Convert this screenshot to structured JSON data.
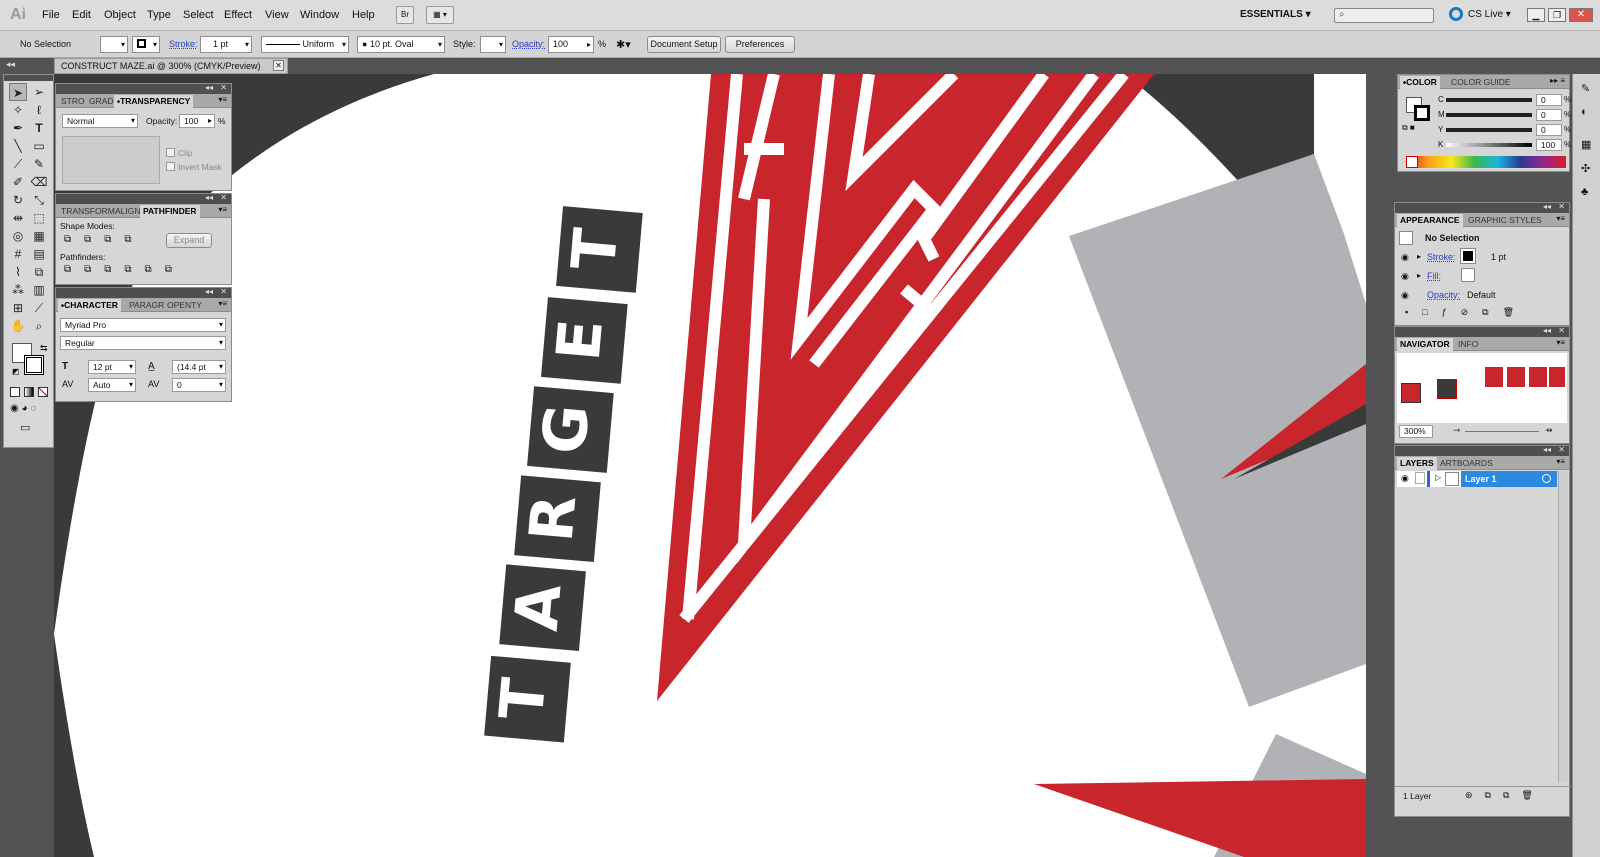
{
  "app": {
    "logo": "Ai"
  },
  "menu": [
    "File",
    "Edit",
    "Object",
    "Type",
    "Select",
    "Effect",
    "View",
    "Window",
    "Help"
  ],
  "menubar": {
    "bridge_btn": "Br",
    "workspace": "ESSENTIALS",
    "search_placeholder": "",
    "cslive": "CS Live"
  },
  "control": {
    "selection": "No Selection",
    "stroke_label": "Stroke:",
    "stroke_value": "1 pt",
    "profile": "Uniform",
    "brush": "10 pt. Oval",
    "style_label": "Style:",
    "opacity_label": "Opacity:",
    "opacity_value": "100",
    "opacity_unit": "%",
    "doc_setup": "Document Setup",
    "prefs": "Preferences"
  },
  "document": {
    "tab": "CONSTRUCT MAZE.ai @ 300% (CMYK/Preview)"
  },
  "transparency_panel": {
    "tabs": [
      "STRO",
      "GRAD",
      "TRANSPARENCY"
    ],
    "blend": "Normal",
    "opacity_label": "Opacity:",
    "opacity": "100",
    "unit": "%",
    "clip": "Clip",
    "invert": "Invert Mask"
  },
  "pathfinder_panel": {
    "tabs": [
      "TRANSFORM",
      "ALIGN",
      "PATHFINDER"
    ],
    "shape_modes": "Shape Modes:",
    "expand": "Expand",
    "pathfinders": "Pathfinders:"
  },
  "character_panel": {
    "tabs": [
      "CHARACTER",
      "PARAGR",
      "OPENTY"
    ],
    "font": "Myriad Pro",
    "style": "Regular",
    "size": "12 pt",
    "leading": "(14.4 pt",
    "kerning": "Auto",
    "tracking": "0"
  },
  "color_panel": {
    "tabs": [
      "COLOR",
      "COLOR GUIDE"
    ],
    "channels": [
      {
        "name": "C",
        "value": "0"
      },
      {
        "name": "M",
        "value": "0"
      },
      {
        "name": "Y",
        "value": "0"
      },
      {
        "name": "K",
        "value": "100"
      }
    ],
    "unit": "%"
  },
  "appearance_panel": {
    "tabs": [
      "APPEARANCE",
      "GRAPHIC STYLES"
    ],
    "title": "No Selection",
    "stroke_label": "Stroke:",
    "stroke_value": "1 pt",
    "fill_label": "Fill:",
    "opacity_label": "Opacity:",
    "opacity_value": "Default"
  },
  "navigator_panel": {
    "tabs": [
      "NAVIGATOR",
      "INFO"
    ],
    "zoom": "300%"
  },
  "layers_panel": {
    "tabs": [
      "LAYERS",
      "ARTBOARDS"
    ],
    "layers": [
      "Layer 1"
    ],
    "footer": "1 Layer"
  },
  "artwork": {
    "letters": [
      "T",
      "A",
      "R",
      "G",
      "E",
      "T"
    ],
    "colors": {
      "red": "#c8252d",
      "dark": "#3a3a3a",
      "gray": "#b1b2b5"
    }
  }
}
